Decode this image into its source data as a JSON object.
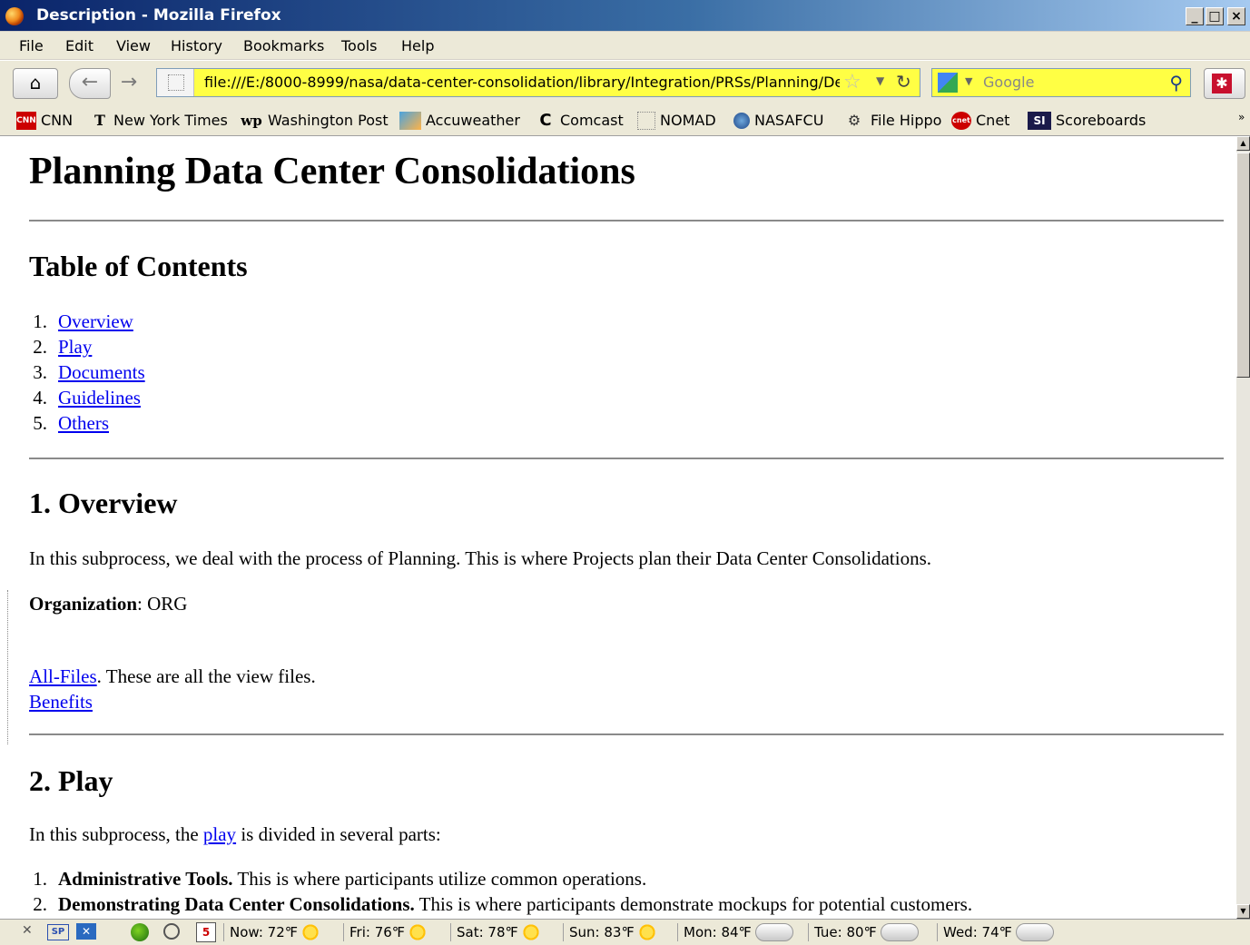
{
  "window": {
    "title": "Description - Mozilla Firefox",
    "controls": [
      "_",
      "□",
      "×"
    ]
  },
  "menubar": {
    "items": [
      "File",
      "Edit",
      "View",
      "History",
      "Bookmarks",
      "Tools",
      "Help"
    ]
  },
  "navbar": {
    "url": "file:///E:/8000-8999/nasa/data-center-consolidation/library/Integration/PRSs/Planning/De:",
    "search_placeholder": "Google",
    "icons": [
      "home-icon",
      "back-arrow-icon",
      "forward-arrow-icon",
      "bookmark-star-icon",
      "reload-icon",
      "search-magnifier-icon"
    ]
  },
  "bookmarks": [
    {
      "label": "CNN",
      "icon": "CNN"
    },
    {
      "label": "New York Times",
      "icon": "T"
    },
    {
      "label": "Washington Post",
      "icon": "wp"
    },
    {
      "label": "Accuweather",
      "icon": ""
    },
    {
      "label": "Comcast",
      "icon": "C"
    },
    {
      "label": "NOMAD",
      "icon": ""
    },
    {
      "label": "NASAFCU",
      "icon": ""
    },
    {
      "label": "File Hippo",
      "icon": ""
    },
    {
      "label": "Cnet",
      "icon": "cnet"
    },
    {
      "label": "Scoreboards",
      "icon": "SI"
    }
  ],
  "page": {
    "title": "Planning Data Center Consolidations",
    "toc_heading": "Table of Contents",
    "toc": [
      "Overview",
      "Play",
      "Documents",
      "Guidelines",
      "Others"
    ],
    "overview": {
      "heading": "1. Overview",
      "text": "In this subprocess, we deal with the process of Planning. This is where Projects plan their Data Center Consolidations.",
      "org_label": "Organization",
      "org_value": ": ORG",
      "all_files_link": "All-Files",
      "all_files_text": ". These are all the view files.",
      "benefits_link": "Benefits"
    },
    "play": {
      "heading": "2. Play",
      "intro_before": "In this subprocess, the ",
      "intro_link": "play",
      "intro_after": " is divided in several parts:",
      "parts": [
        {
          "bold": "Administrative Tools.",
          "text": " This is where participants utilize common operations."
        },
        {
          "bold": "Demonstrating Data Center Consolidations.",
          "text": " This is where participants demonstrate mockups for potential customers."
        }
      ]
    }
  },
  "statusbar": {
    "sp": "SP",
    "calendar_day": "5",
    "weather": [
      "Now: 72℉",
      "Fri: 76℉",
      "Sat: 78℉",
      "Sun: 83℉",
      "Mon: 84℉",
      "Tue: 80℉",
      "Wed: 74℉"
    ]
  }
}
